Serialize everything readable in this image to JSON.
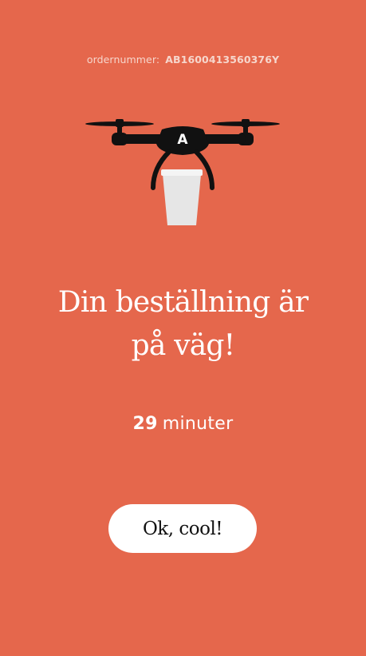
{
  "order": {
    "label": "ordernummer:",
    "number": "AB1600413560376Y"
  },
  "illustration": {
    "drone_icon": "drone-icon",
    "cup_icon": "coffee-cup-icon",
    "logo_letter": "A"
  },
  "status": {
    "title_line1": "Din beställning är",
    "title_line2": "på väg!"
  },
  "eta": {
    "value": "29",
    "unit": "minuter"
  },
  "actions": {
    "confirm_label": "Ok, cool!"
  },
  "colors": {
    "background": "#e5674c",
    "button": "#ffffff",
    "drone": "#111111",
    "cup": "#e6e6e6"
  }
}
